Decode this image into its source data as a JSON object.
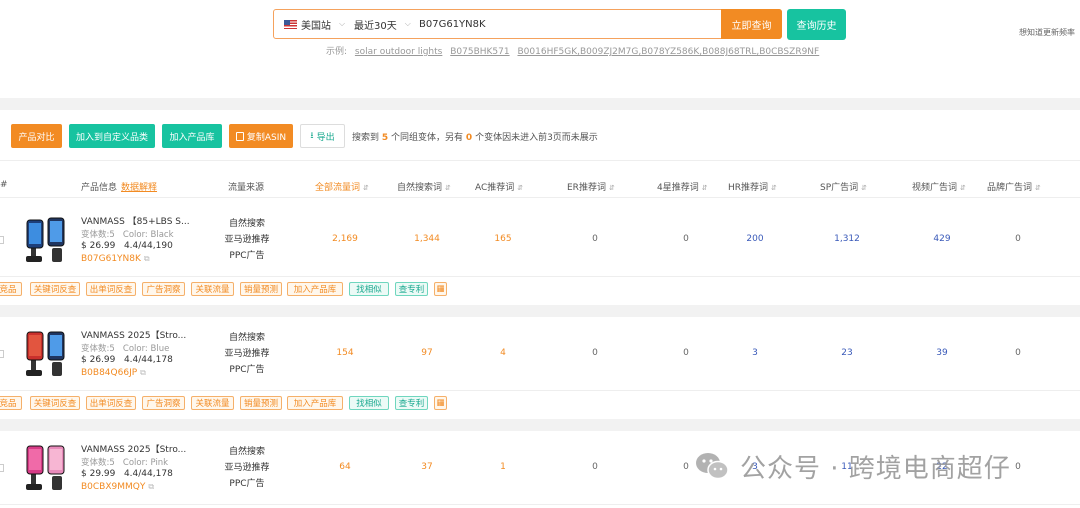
{
  "search": {
    "site": "美国站",
    "date_range": "最近30天",
    "query": "B07G61YN8K",
    "query_button": "立即查询",
    "history_button": "查询历史",
    "howto_link": "想知道更新频率",
    "examples_label": "示例:",
    "examples": [
      "solar outdoor lights",
      "B075BHK571",
      "B0016HF5GK,B009ZJ2M7G,B078YZ586K,B088J68TRL,B0CBSZR9NF"
    ]
  },
  "toolbar": {
    "compare": "产品对比",
    "add_custom": "加入到自定义品类",
    "add_library": "加入产品库",
    "copy_asin": "复制ASIN",
    "export": "导出",
    "info_pre": "搜索到",
    "found": "5",
    "info_mid": "个同组变体，另有",
    "missing": "0",
    "info_post": "个变体因未进入前3页而未展示"
  },
  "table": {
    "headers": {
      "index": "#",
      "product": "产品信息",
      "product_hint": "数据解释",
      "source": "流量来源",
      "all_keywords": "全部流量词",
      "organic": "自然搜索词",
      "ac": "AC推荐词",
      "er": "ER推荐词",
      "four_star": "4星推荐词",
      "hr": "HR推荐词",
      "sp": "SP广告词",
      "video": "视频广告词",
      "brand": "品牌广告词"
    },
    "sources": [
      "自然搜索",
      "亚马逊推荐",
      "PPC广告"
    ],
    "rows": [
      {
        "title": "VANMASS 【85+LBS S...",
        "variants": "变体数:5",
        "color": "Color: Black",
        "price": "$ 26.99",
        "rating": "4.4/44,190",
        "asin": "B07G61YN8K",
        "all": "2,169",
        "organic": "1,344",
        "ac": "165",
        "er": "0",
        "four_star": "0",
        "hr": "200",
        "sp": "1,312",
        "video": "429",
        "brand": "0"
      },
      {
        "title": "VANMASS 2025【Stro...",
        "variants": "变体数:5",
        "color": "Color: Blue",
        "price": "$ 26.99",
        "rating": "4.4/44,178",
        "asin": "B0B84Q66JP",
        "all": "154",
        "organic": "97",
        "ac": "4",
        "er": "0",
        "four_star": "0",
        "hr": "3",
        "sp": "23",
        "video": "39",
        "brand": "0"
      },
      {
        "title": "VANMASS 2025【Stro...",
        "variants": "变体数:5",
        "color": "Color: Pink",
        "price": "$ 29.99",
        "rating": "4.4/44,178",
        "asin": "B0CBX9MMQY",
        "all": "64",
        "organic": "37",
        "ac": "1",
        "er": "0",
        "four_star": "0",
        "hr": "3",
        "sp": "11",
        "video": "22",
        "brand": "0"
      }
    ],
    "tags": [
      "竞品",
      "关键词反查",
      "出单词反查",
      "广告洞察",
      "关联流量",
      "销量预测",
      "加入产品库",
      "找相似",
      "查专利"
    ]
  },
  "watermark": "公众号 · 跨境电商超仔",
  "colors": {
    "accent_orange": "#f28b23",
    "accent_teal": "#17c3a0",
    "link_blue": "#3a5ab9"
  }
}
